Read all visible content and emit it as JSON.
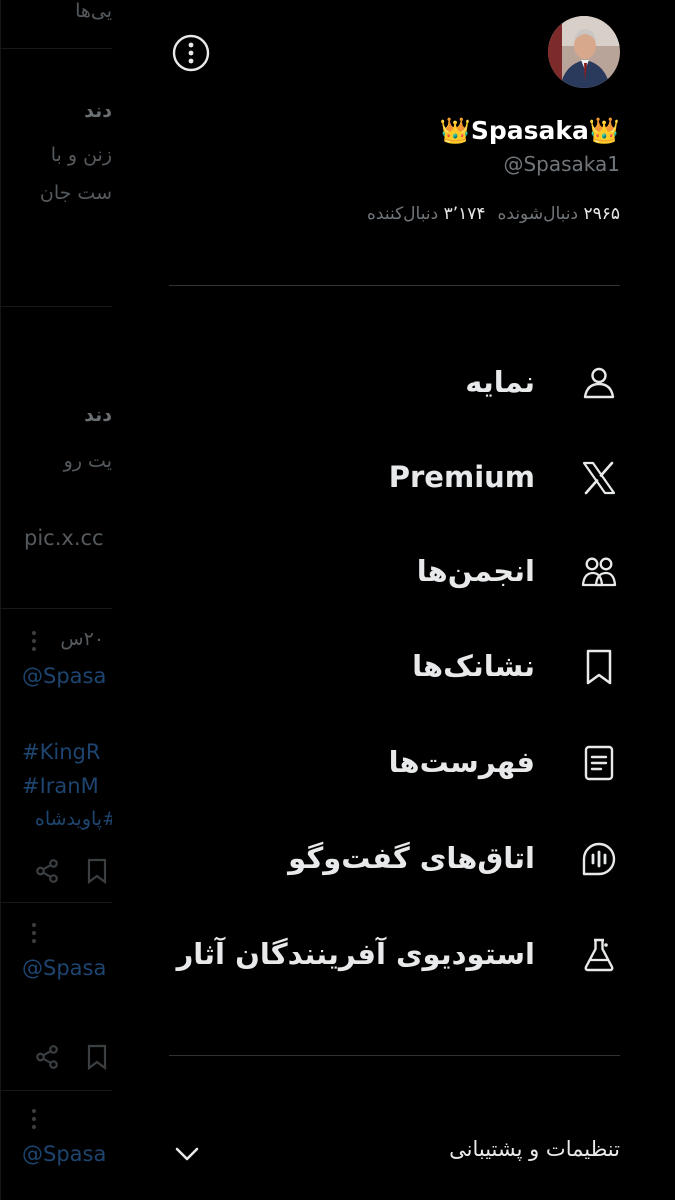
{
  "background_feed": {
    "top_fragment": "یی‌ها",
    "tweet1_line1": "دند",
    "tweet1_line2": "زنن و با",
    "tweet1_line3": "ست جان",
    "tweet2_line1": "دند",
    "tweet2_line2": "یت رو",
    "link_fragment": "pic.x.cc",
    "time_fragment": "۲۰س",
    "handle_fragment1": "@Spasa",
    "hashtag1": "#KingR",
    "hashtag2": "#IranM",
    "hashtag3": "#پاویدشاه",
    "handle_fragment2": "@Spasa",
    "handle_fragment3": "@Spasa"
  },
  "profile": {
    "display_name": "Spasaka",
    "crown_emoji": "👑",
    "handle": "@Spasaka1",
    "following_count": "۲۹۶۵",
    "following_label": "دنبال‌شونده",
    "followers_count": "۳٬۱۷۴",
    "followers_label": "دنبال‌کننده"
  },
  "menu": [
    {
      "label": "نمایه",
      "icon": "profile-person-icon"
    },
    {
      "label": "Premium",
      "icon": "x-logo-icon"
    },
    {
      "label": "انجمن‌ها",
      "icon": "communities-icon"
    },
    {
      "label": "نشانک‌ها",
      "icon": "bookmark-icon"
    },
    {
      "label": "فهرست‌ها",
      "icon": "lists-icon"
    },
    {
      "label": "اتاق‌های گفت‌وگو",
      "icon": "spaces-icon"
    },
    {
      "label": "استودیوی آفرینندگان آثار",
      "icon": "creator-studio-flask-icon"
    }
  ],
  "settings": {
    "label": "تنظیمات و پشتیبانی"
  },
  "colors": {
    "background": "#000000",
    "text_primary": "#e7e9ea",
    "text_secondary": "#71767b",
    "divider": "#2f3336",
    "crown": "#f5c518"
  }
}
